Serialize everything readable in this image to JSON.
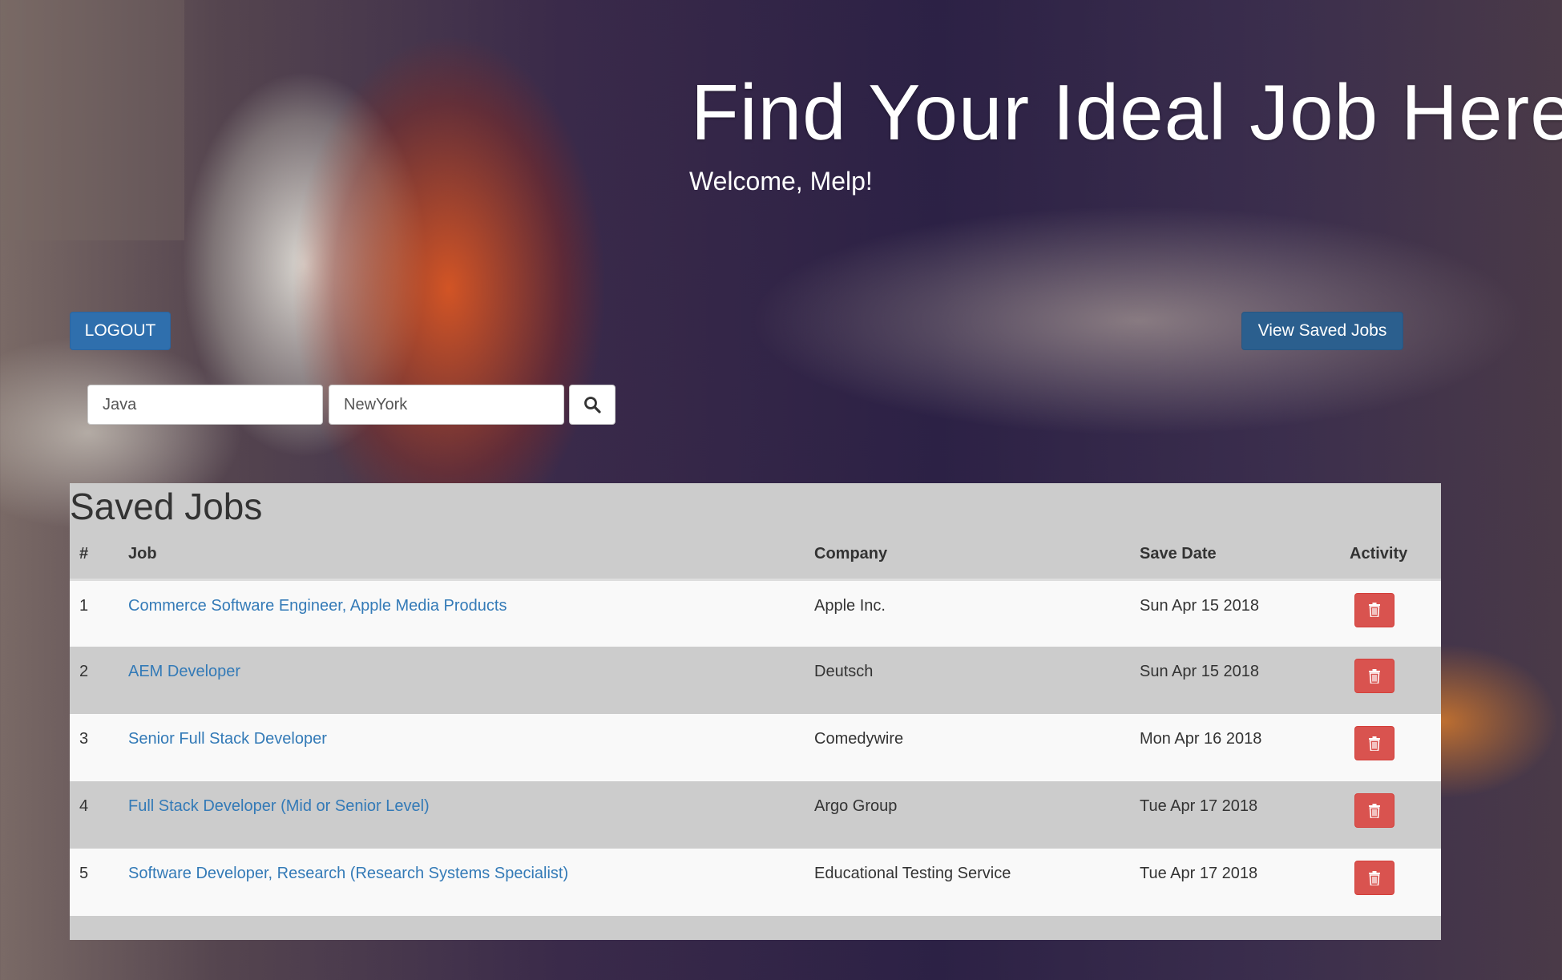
{
  "hero": {
    "title": "Find Your Ideal Job Here",
    "welcome": "Welcome, Melp!"
  },
  "header": {
    "logout_label": "LOGOUT",
    "view_saved_label": "View Saved Jobs"
  },
  "search": {
    "keyword_value": "Java",
    "location_value": "NewYork",
    "search_icon": "search-icon"
  },
  "saved_jobs": {
    "title": "Saved Jobs",
    "columns": [
      "#",
      "Job",
      "Company",
      "Save Date",
      "Activity"
    ],
    "rows": [
      {
        "num": "1",
        "job": "Commerce Software Engineer, Apple Media Products",
        "company": "Apple Inc.",
        "date": "Sun Apr 15 2018"
      },
      {
        "num": "2",
        "job": "AEM Developer",
        "company": "Deutsch",
        "date": "Sun Apr 15 2018"
      },
      {
        "num": "3",
        "job": "Senior Full Stack Developer",
        "company": "Comedywire",
        "date": "Mon Apr 16 2018"
      },
      {
        "num": "4",
        "job": "Full Stack Developer (Mid or Senior Level)",
        "company": "Argo Group",
        "date": "Tue Apr 17 2018"
      },
      {
        "num": "5",
        "job": "Software Developer, Research (Research Systems Specialist)",
        "company": "Educational Testing Service",
        "date": "Tue Apr 17 2018"
      }
    ],
    "delete_icon": "trash-icon"
  },
  "colors": {
    "primary": "#2f6fad",
    "danger": "#d9534f",
    "link": "#337ab7",
    "panel": "#cccccc"
  }
}
